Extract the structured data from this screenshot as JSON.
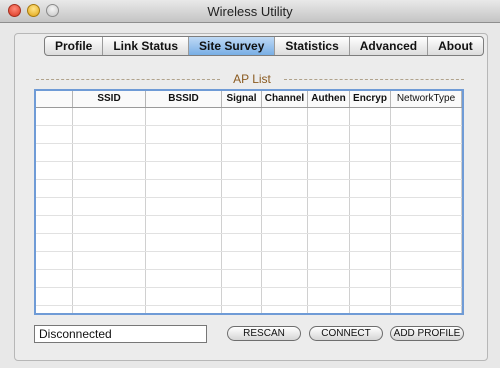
{
  "window": {
    "title": "Wireless Utility"
  },
  "tabs": [
    {
      "label": "Profile"
    },
    {
      "label": "Link Status"
    },
    {
      "label": "Site Survey",
      "active": true
    },
    {
      "label": "Statistics"
    },
    {
      "label": "Advanced"
    },
    {
      "label": "About"
    }
  ],
  "ap_list": {
    "title": "AP List",
    "columns": [
      "",
      "SSID",
      "BSSID",
      "Signal",
      "Channel",
      "Authen",
      "Encryp",
      "NetworkType"
    ],
    "rows": []
  },
  "status": {
    "text": "Disconnected"
  },
  "buttons": {
    "rescan": "RESCAN",
    "connect": "CONNECT",
    "add_profile": "ADD PROFILE"
  },
  "colors": {
    "accent": "#78aee5",
    "table_border": "#6f9bd6",
    "group_title": "#8a5a20"
  }
}
